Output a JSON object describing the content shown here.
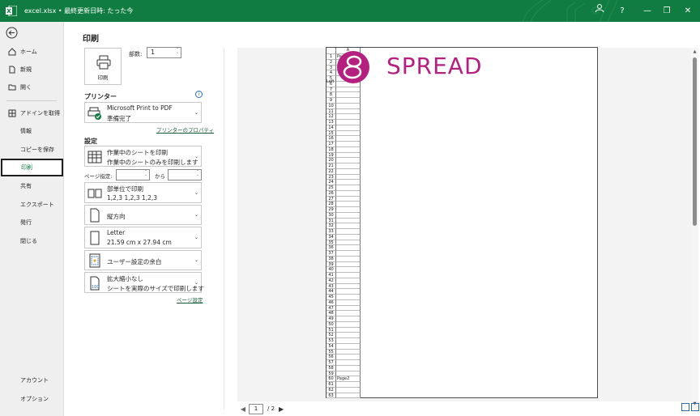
{
  "titlebar": {
    "title": "excel.xlsx • 最終更新日時: たった今",
    "buttons": {
      "help": "?",
      "minimize": "—",
      "restore": "❐",
      "close": "✕"
    }
  },
  "sidebar": {
    "items": [
      {
        "label": "ホーム",
        "icon": "home-icon"
      },
      {
        "label": "新規",
        "icon": "new-file-icon"
      },
      {
        "label": "開く",
        "icon": "folder-open-icon"
      },
      {
        "label": "アドインを取得",
        "icon": "grid-icon"
      },
      {
        "label": "情報"
      },
      {
        "label": "コピーを保存"
      },
      {
        "label": "印刷",
        "selected": true
      },
      {
        "label": "共有"
      },
      {
        "label": "エクスポート"
      },
      {
        "label": "発行"
      },
      {
        "label": "閉じる"
      }
    ],
    "bottom_items": [
      {
        "label": "アカウント"
      },
      {
        "label": "オプション"
      }
    ]
  },
  "main": {
    "title": "印刷",
    "print_button_label": "印刷",
    "copies_label": "部数:",
    "copies_value": "1",
    "printer_section": "プリンター",
    "printer": {
      "name": "Microsoft Print to PDF",
      "status": "準備完了"
    },
    "printer_properties_link": "プリンターのプロパティ",
    "settings_section": "設定",
    "settings": [
      {
        "line1": "作業中のシートを印刷",
        "line2": "作業中のシートのみを印刷します"
      },
      {
        "line1": "部単位で印刷",
        "line2": "1,2,3    1,2,3    1,2,3"
      },
      {
        "line1": "縦方向",
        "line2": ""
      },
      {
        "line1": "Letter",
        "line2": "21.59 cm x 27.94 cm"
      },
      {
        "line1": "ユーザー設定の余白",
        "line2": ""
      },
      {
        "line1": "拡大縮小なし",
        "line2": "シートを実際のサイズで印刷します"
      }
    ],
    "page_range_label": "ページ指定:",
    "page_range_to": "から",
    "page_setup_link": "ページ設定"
  },
  "preview": {
    "column_header": "A",
    "row_count": 63,
    "cell_texts": {
      "1": "Page1",
      "60": "Page2"
    },
    "overflow_text": "Left",
    "logo_text": "SPREAD",
    "brand_color": "#b51f7f",
    "current_page": "1",
    "total_pages": "/ 2"
  },
  "colors": {
    "accent": "#107c41",
    "brand": "#b51f7f"
  }
}
